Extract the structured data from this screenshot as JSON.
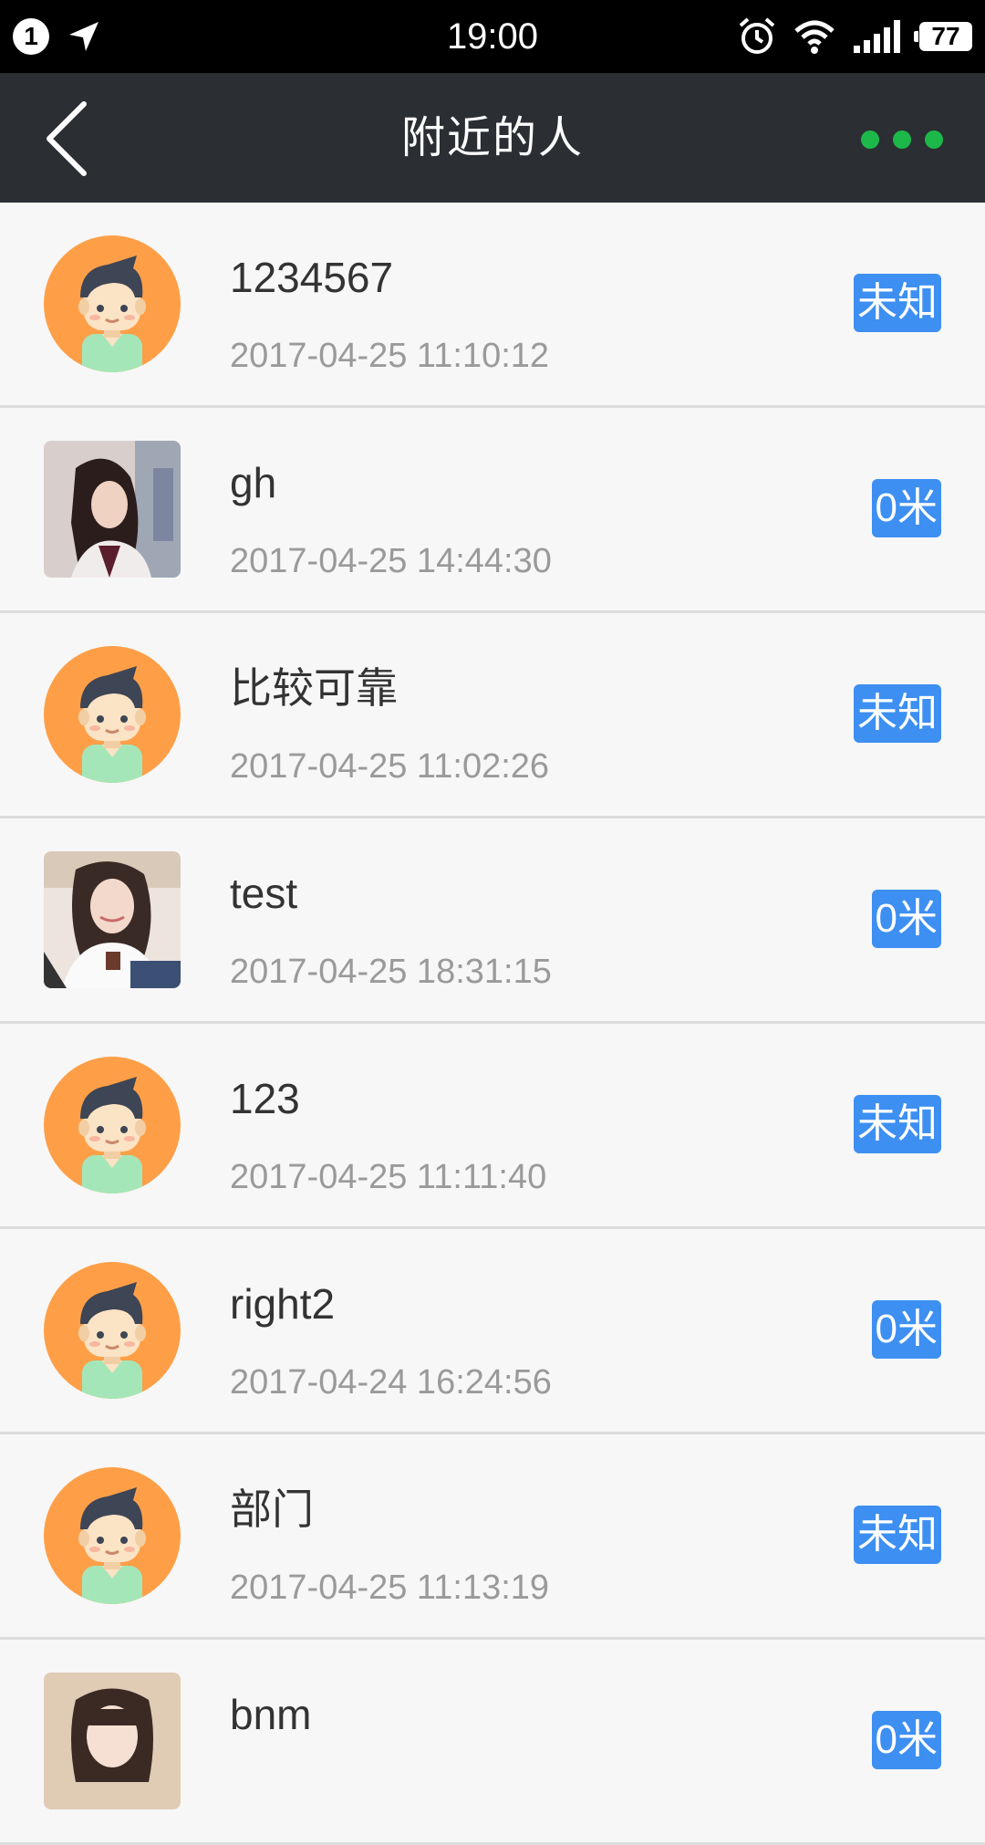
{
  "status_bar": {
    "notification_count": "1",
    "time": "19:00",
    "battery": "77",
    "icons": [
      "location-arrow-icon",
      "alarm-icon",
      "wifi-icon",
      "signal-icon",
      "battery-icon"
    ]
  },
  "nav": {
    "title": "附近的人",
    "back_icon": "chevron-left-icon",
    "more_icon": "more-dots-icon",
    "accent_color": "#1db84a"
  },
  "colors": {
    "nav_bg": "#2b2e33",
    "badge_bg": "#3d8ff2",
    "avatar_default_bg": "#fe9f48"
  },
  "people": [
    {
      "name": "1234567",
      "time": "2017-04-25 11:10:12",
      "distance": "未知",
      "avatar": "default-avatar"
    },
    {
      "name": "gh",
      "time": "2017-04-25 14:44:30",
      "distance": "0米",
      "avatar": "photo-woman-side"
    },
    {
      "name": "比较可靠",
      "time": "2017-04-25 11:02:26",
      "distance": "未知",
      "avatar": "default-avatar"
    },
    {
      "name": "test",
      "time": "2017-04-25 18:31:15",
      "distance": "0米",
      "avatar": "photo-woman-smile"
    },
    {
      "name": "123",
      "time": "2017-04-25 11:11:40",
      "distance": "未知",
      "avatar": "default-avatar"
    },
    {
      "name": "right2",
      "time": "2017-04-24 16:24:56",
      "distance": "0米",
      "avatar": "default-avatar"
    },
    {
      "name": "部门",
      "time": "2017-04-25 11:13:19",
      "distance": "未知",
      "avatar": "default-avatar"
    },
    {
      "name": "bnm",
      "time": "",
      "distance": "0米",
      "avatar": "photo-girl"
    }
  ]
}
